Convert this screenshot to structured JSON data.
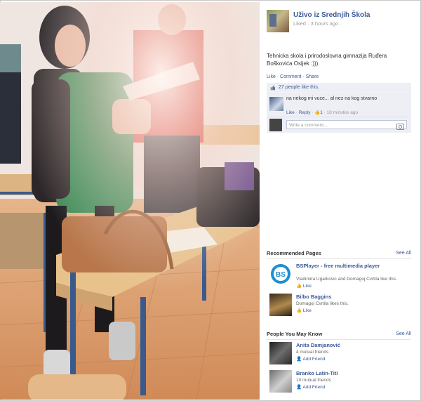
{
  "post": {
    "page_name": "Uživo iz Srednjih Škola",
    "meta": "Liked · 3 hours ago ·",
    "text": "Tehnicka skola i prirodoslovna gimnazija Ruđera Boškovića Osijek :)))",
    "actions": "Like · Comment · Share",
    "likes": "27 people like this.",
    "comment": {
      "author": "",
      "text": "na nekog mi vuce... al nez na kog stvarno",
      "meta_like": "Like",
      "meta_reply": "Reply",
      "meta_count": "1",
      "meta_time": "18 minutes ago"
    },
    "write_placeholder": "Write a comment..."
  },
  "recommended": {
    "title": "Recommended Pages",
    "see_all": "See All",
    "items": [
      {
        "name": "BSPlayer - free multimedia player",
        "sub": "Vladimira Ugarkovic and Domagoj Cvrtila like this.",
        "action": "Like"
      },
      {
        "name": "Bilbo Baggins",
        "sub": "Domagoj Cvrtila likes this.",
        "action": "Like"
      }
    ]
  },
  "people": {
    "title": "People You May Know",
    "see_all": "See All",
    "items": [
      {
        "name": "Anita Damjanović",
        "sub": "4 mutual friends",
        "action": "Add Friend"
      },
      {
        "name": "Branko Latin-Titi",
        "sub": "10 mutual friends",
        "action": "Add Friend"
      }
    ]
  },
  "colors": {
    "link": "#3b5998",
    "panel": "#edeff4"
  }
}
